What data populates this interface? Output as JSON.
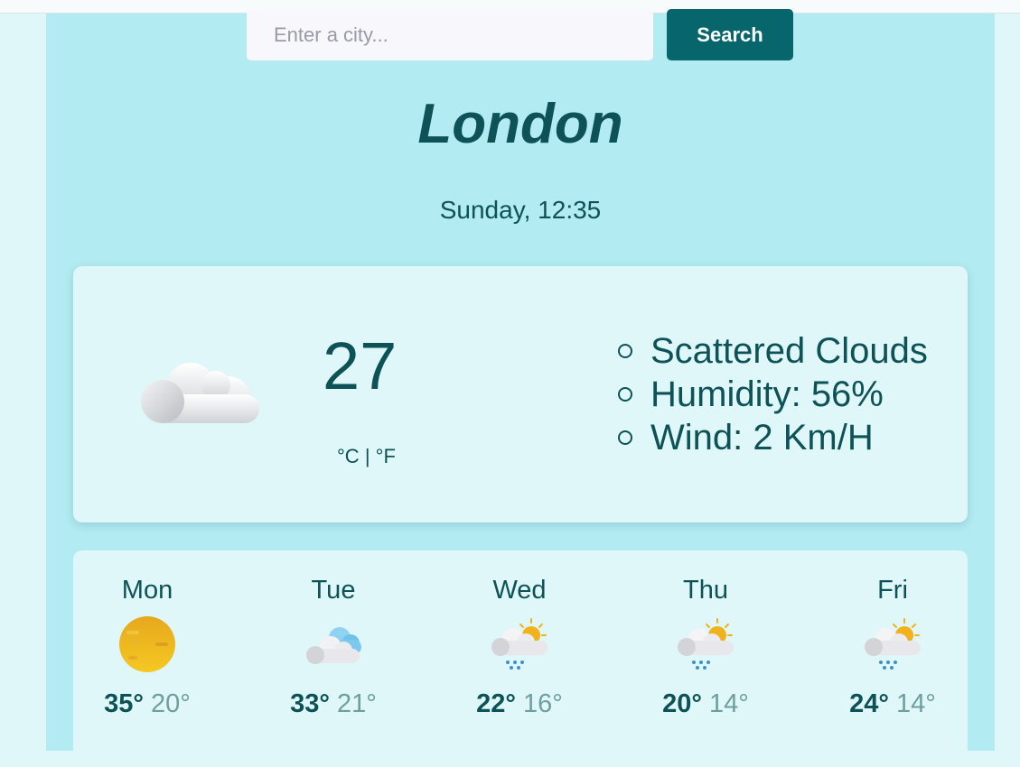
{
  "search": {
    "placeholder": "Enter a city...",
    "button_label": "Search"
  },
  "city": "London",
  "datetime": "Sunday, 12:35",
  "current": {
    "icon": "cloud-icon",
    "temperature": "27",
    "unit_celsius": "°C",
    "unit_separator": "|",
    "unit_fahrenheit": "°F",
    "details": [
      "Scattered Clouds",
      "Humidity: 56%",
      "Wind: 2 Km/H"
    ]
  },
  "forecast": [
    {
      "day": "Mon",
      "icon": "sun-icon",
      "high": "35°",
      "low": "20°"
    },
    {
      "day": "Tue",
      "icon": "cloudy-icon",
      "high": "33°",
      "low": "21°"
    },
    {
      "day": "Wed",
      "icon": "rain-sun-icon",
      "high": "22°",
      "low": "16°"
    },
    {
      "day": "Thu",
      "icon": "rain-sun-icon",
      "high": "20°",
      "low": "14°"
    },
    {
      "day": "Fri",
      "icon": "rain-sun-icon",
      "high": "24°",
      "low": "14°"
    }
  ],
  "colors": {
    "accent": "#07666b",
    "text": "#0d5257",
    "panel": "#b3ebf2",
    "card": "#e0f7f9",
    "low_temp": "#6e9e9e"
  }
}
